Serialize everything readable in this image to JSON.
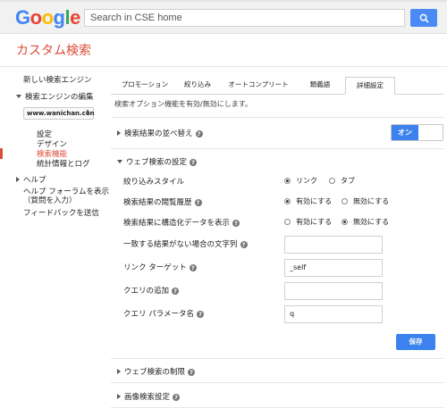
{
  "header": {
    "logo_letters": [
      {
        "ch": "G",
        "color": "#4285f4"
      },
      {
        "ch": "o",
        "color": "#ea4335"
      },
      {
        "ch": "o",
        "color": "#fbbc05"
      },
      {
        "ch": "g",
        "color": "#4285f4"
      },
      {
        "ch": "l",
        "color": "#34a853"
      },
      {
        "ch": "e",
        "color": "#ea4335"
      }
    ],
    "search_placeholder": "Search in CSE home",
    "search_icon": "search-icon"
  },
  "page_title": "カスタム検索",
  "sidebar": {
    "new_engine": "新しい検索エンジン",
    "edit_engine": "検索エンジンの編集",
    "engine_select_value": "www.wanichan.con",
    "sub_items": [
      "設定",
      "デザイン",
      "検索機能",
      "統計情報とログ"
    ],
    "active_item": "検索機能",
    "help": "ヘルプ",
    "help_forum_line1": "ヘルプ フォーラムを表示",
    "help_forum_line2": "（質問を入力）",
    "feedback": "フィードバックを送信"
  },
  "tabs": [
    "プロモーション",
    "絞り込み",
    "オートコンプリート",
    "類義語",
    "詳細設定"
  ],
  "active_tab": "詳細設定",
  "description": "検索オプション機能を有効/無効にします。",
  "sections": {
    "sort": {
      "label": "検索結果の並べ替え",
      "toggle_label": "オン",
      "toggle_on": true
    },
    "web_search": {
      "label": "ウェブ検索の設定",
      "expanded": true
    },
    "web_restrictions": {
      "label": "ウェブ検索の制限"
    },
    "image_search": {
      "label": "画像検索設定"
    }
  },
  "settings": {
    "refine_style": {
      "label": "絞り込みスタイル",
      "options": [
        "リンク",
        "タブ"
      ],
      "selected": "リンク"
    },
    "history": {
      "label": "検索結果の閲覧履歴",
      "options": [
        "有効にする",
        "無効にする"
      ],
      "selected": "有効にする"
    },
    "structured": {
      "label": "検索結果に構造化データを表示",
      "options": [
        "有効にする",
        "無効にする"
      ],
      "selected": "無効にする"
    },
    "no_results_text": {
      "label": "一致する結果がない場合の文字列",
      "value": ""
    },
    "link_target": {
      "label": "リンク ターゲット",
      "value": "_self"
    },
    "query_add": {
      "label": "クエリの追加",
      "value": ""
    },
    "query_param": {
      "label": "クエリ パラメータ名",
      "value": "q"
    }
  },
  "save_label": "保存",
  "colors": {
    "accent_blue": "#3b82ee",
    "brand_red": "#dd4b39"
  }
}
